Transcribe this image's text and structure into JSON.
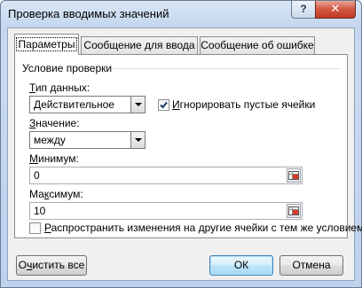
{
  "window": {
    "title": "Проверка вводимых значений",
    "help_label": "?",
    "close_label": "✕"
  },
  "tabs": [
    {
      "label": "Параметры",
      "active": true
    },
    {
      "label": "Сообщение для ввода",
      "active": false
    },
    {
      "label": "Сообщение об ошибке",
      "active": false
    }
  ],
  "validation": {
    "group_label": "Условие проверки",
    "data_type_label_pre": "",
    "data_type_label_u": "Т",
    "data_type_label_post": "ип данных:",
    "data_type_value": "Действительное",
    "ignore_blank_pre": "",
    "ignore_blank_u": "И",
    "ignore_blank_post": "гнорировать пустые ячейки",
    "ignore_blank_checked": true,
    "operator_label_pre": "",
    "operator_label_u": "З",
    "operator_label_post": "начение:",
    "operator_value": "между",
    "min_label_pre": "",
    "min_label_u": "М",
    "min_label_post": "инимум:",
    "min_value": "0",
    "max_label_pre": "Ма",
    "max_label_u": "к",
    "max_label_post": "симум:",
    "max_value": "10"
  },
  "apply_all": {
    "label_pre": "",
    "label_u": "Р",
    "label_post": "аспространить изменения на другие ячейки с тем же условием",
    "checked": false
  },
  "buttons": {
    "clear_all_pre": "О",
    "clear_all_u": "ч",
    "clear_all_post": "истить все",
    "ok": "ОК",
    "cancel": "Отмена"
  },
  "icons": {
    "range_select": "range-select-icon",
    "checkmark": "checkmark-icon",
    "dropdown": "chevron-down-icon"
  }
}
